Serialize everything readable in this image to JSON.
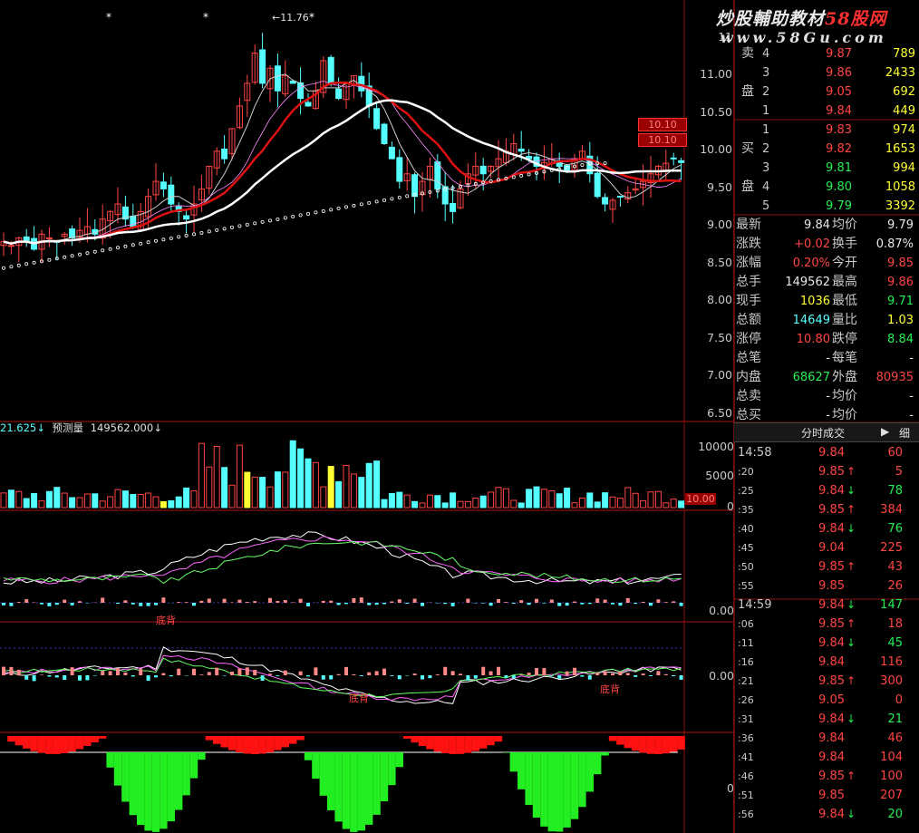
{
  "watermark": {
    "line1_prefix": "炒股輔助教材",
    "line1_brand": "58股网",
    "line2": "www.58Gu.com"
  },
  "price_axis": {
    "labels": [
      "11",
      "11.00",
      "10.50",
      "10.00",
      "9.50",
      "9.00",
      "8.50",
      "8.00",
      "7.50",
      "7.00",
      "6.50"
    ]
  },
  "peak_label": "11.76",
  "badges": {
    "current_price": "10.10",
    "volume": "10.00"
  },
  "volume_panel": {
    "header_left": "21.625↓",
    "header_label": "预测量",
    "header_value": "149562.000↓",
    "axis_labels": [
      "10000",
      "5000",
      "0"
    ]
  },
  "indicator1": {
    "axis_label": "0.00",
    "signal_label": "底背"
  },
  "indicator2": {
    "axis_label": "0.00",
    "signal_labels": [
      "底背",
      "底背"
    ]
  },
  "indicator3": {
    "axis_label": "0"
  },
  "order_book": {
    "sell_label_1": "卖",
    "sell_label_2": "盘",
    "buy_label_1": "买",
    "buy_label_2": "盘",
    "sells": [
      {
        "idx": "4",
        "price": "9.87",
        "vol": "789"
      },
      {
        "idx": "3",
        "price": "9.86",
        "vol": "2433"
      },
      {
        "idx": "2",
        "price": "9.05",
        "vol": "692"
      },
      {
        "idx": "1",
        "price": "9.84",
        "vol": "449"
      }
    ],
    "buys": [
      {
        "idx": "1",
        "price": "9.83",
        "vol": "974"
      },
      {
        "idx": "2",
        "price": "9.82",
        "vol": "1653"
      },
      {
        "idx": "3",
        "price": "9.81",
        "vol": "994"
      },
      {
        "idx": "4",
        "price": "9.80",
        "vol": "1058"
      },
      {
        "idx": "5",
        "price": "9.79",
        "vol": "3392"
      }
    ]
  },
  "stats": [
    {
      "l1": "最新",
      "v1": "9.84",
      "c1": "wht",
      "l2": "均价",
      "v2": "9.79",
      "c2": "wht"
    },
    {
      "l1": "涨跌",
      "v1": "+0.02",
      "c1": "red",
      "l2": "换手",
      "v2": "0.87%",
      "c2": "wht"
    },
    {
      "l1": "涨幅",
      "v1": "0.20%",
      "c1": "red",
      "l2": "今开",
      "v2": "9.85",
      "c2": "red"
    },
    {
      "l1": "总手",
      "v1": "149562",
      "c1": "wht",
      "l2": "最高",
      "v2": "9.86",
      "c2": "red"
    },
    {
      "l1": "现手",
      "v1": "1036",
      "c1": "yel",
      "l2": "最低",
      "v2": "9.71",
      "c2": "grn"
    },
    {
      "l1": "总额",
      "v1": "14649",
      "c1": "cyn",
      "l2": "量比",
      "v2": "1.03",
      "c2": "yel"
    },
    {
      "l1": "涨停",
      "v1": "10.80",
      "c1": "red",
      "l2": "跌停",
      "v2": "8.84",
      "c2": "grn"
    },
    {
      "l1": "总笔",
      "v1": "-",
      "c1": "wht",
      "l2": "每笔",
      "v2": "-",
      "c2": "wht"
    },
    {
      "l1": "内盘",
      "v1": "68627",
      "c1": "grn",
      "l2": "外盘",
      "v2": "80935",
      "c2": "red"
    },
    {
      "l1": "总卖",
      "v1": "-",
      "c1": "wht",
      "l2": "均价",
      "v2": "-",
      "c2": "wht"
    },
    {
      "l1": "总买",
      "v1": "-",
      "c1": "wht",
      "l2": "均价",
      "v2": "-",
      "c2": "wht"
    }
  ],
  "tabs": {
    "active": "分时成交",
    "next_icon": "▶",
    "other": "细"
  },
  "ticks": [
    {
      "time": "14:58",
      "price": "9.84",
      "pc": "red",
      "arrow": "",
      "ac": "",
      "vol": "60"
    },
    {
      "time": ":20",
      "price": "9.85",
      "pc": "red",
      "arrow": "↑",
      "ac": "red",
      "vol": "5"
    },
    {
      "time": ":25",
      "price": "9.84",
      "pc": "red",
      "arrow": "↓",
      "ac": "grn",
      "vol": "78"
    },
    {
      "time": ":35",
      "price": "9.85",
      "pc": "red",
      "arrow": "↑",
      "ac": "red",
      "vol": "384"
    },
    {
      "time": ":40",
      "price": "9.84",
      "pc": "red",
      "arrow": "↓",
      "ac": "grn",
      "vol": "76"
    },
    {
      "time": ":45",
      "price": "9.04",
      "pc": "red",
      "arrow": "",
      "ac": "",
      "vol": "225"
    },
    {
      "time": ":50",
      "price": "9.85",
      "pc": "red",
      "arrow": "↑",
      "ac": "red",
      "vol": "43"
    },
    {
      "time": ":55",
      "price": "9.85",
      "pc": "red",
      "arrow": "",
      "ac": "",
      "vol": "26"
    },
    {
      "time": "14:59",
      "price": "9.84",
      "pc": "red",
      "arrow": "↓",
      "ac": "grn",
      "vol": "147"
    },
    {
      "time": ":06",
      "price": "9.85",
      "pc": "red",
      "arrow": "↑",
      "ac": "red",
      "vol": "18"
    },
    {
      "time": ":11",
      "price": "9.84",
      "pc": "red",
      "arrow": "↓",
      "ac": "grn",
      "vol": "45"
    },
    {
      "time": ":16",
      "price": "9.84",
      "pc": "red",
      "arrow": "",
      "ac": "",
      "vol": "116"
    },
    {
      "time": ":21",
      "price": "9.85",
      "pc": "red",
      "arrow": "↑",
      "ac": "red",
      "vol": "300"
    },
    {
      "time": ":26",
      "price": "9.05",
      "pc": "red",
      "arrow": "",
      "ac": "",
      "vol": "0"
    },
    {
      "time": ":31",
      "price": "9.84",
      "pc": "red",
      "arrow": "↓",
      "ac": "grn",
      "vol": "21"
    },
    {
      "time": ":36",
      "price": "9.84",
      "pc": "red",
      "arrow": "",
      "ac": "",
      "vol": "46"
    },
    {
      "time": ":41",
      "price": "9.84",
      "pc": "red",
      "arrow": "",
      "ac": "",
      "vol": "104"
    },
    {
      "time": ":46",
      "price": "9.85",
      "pc": "red",
      "arrow": "↑",
      "ac": "red",
      "vol": "100"
    },
    {
      "time": ":51",
      "price": "9.85",
      "pc": "red",
      "arrow": "",
      "ac": "",
      "vol": "207"
    },
    {
      "time": ":56",
      "price": "9.84",
      "pc": "red",
      "arrow": "↓",
      "ac": "grn",
      "vol": "20"
    }
  ],
  "colors": {
    "up": "#ff4444",
    "down": "#55ffff",
    "ma_white": "#ffffff",
    "ma_red": "#dd1111",
    "grid": "#8b1010"
  }
}
